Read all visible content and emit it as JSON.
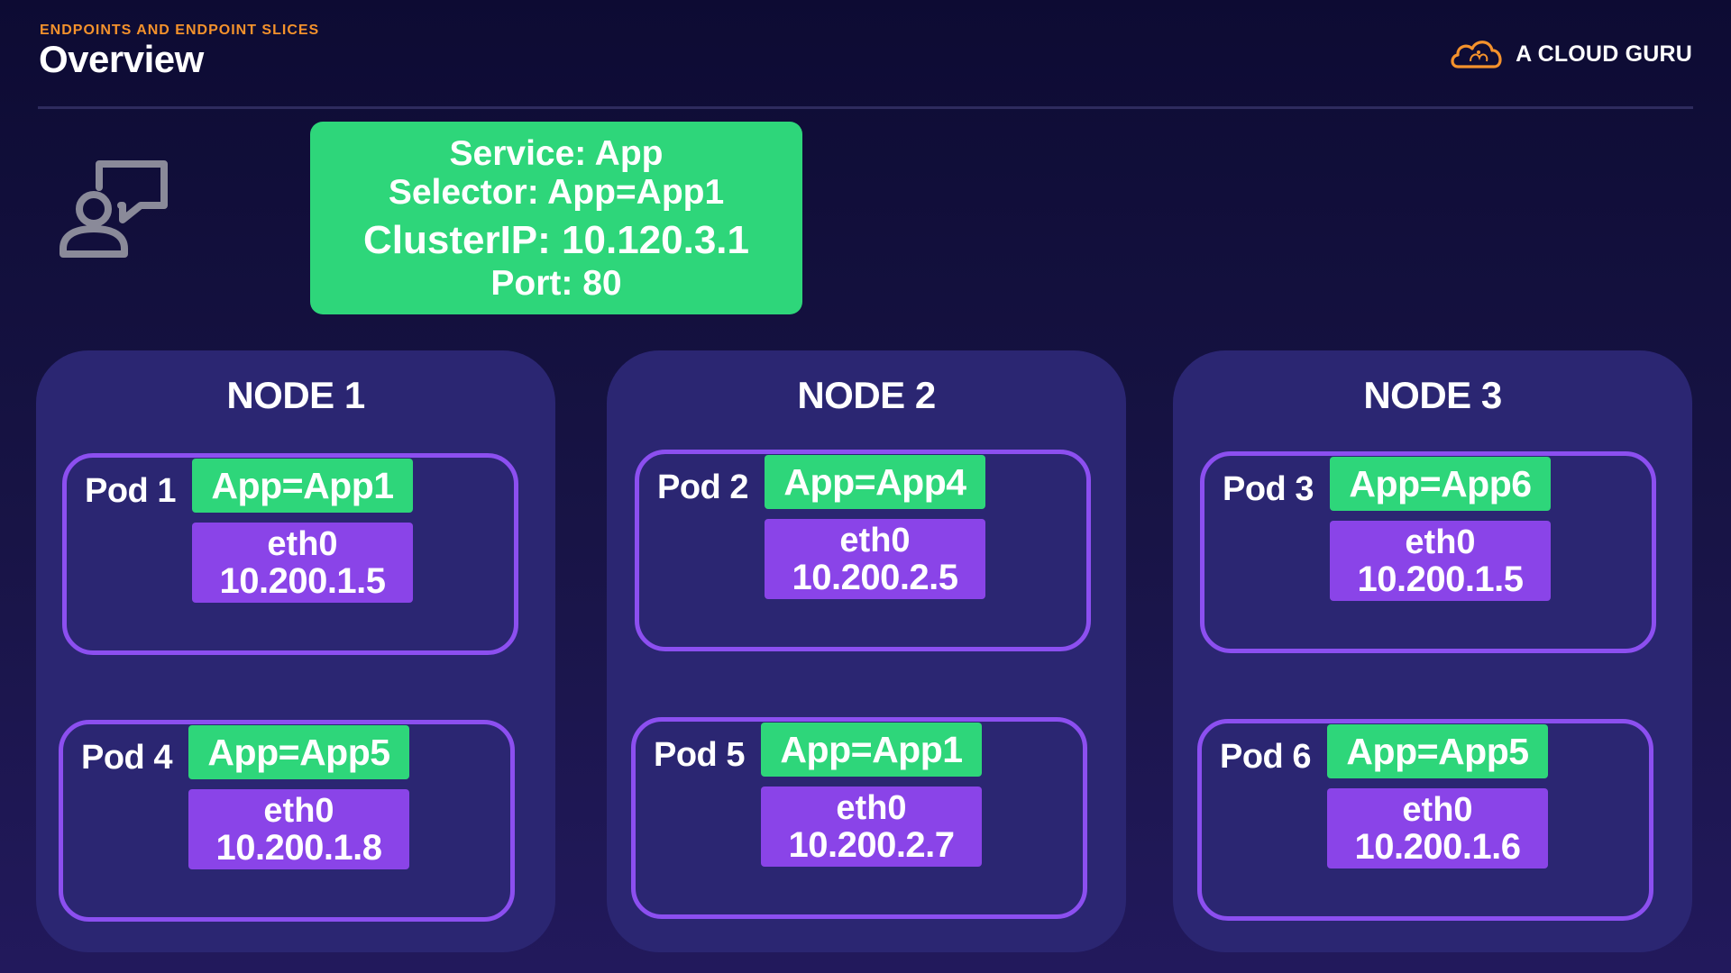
{
  "header": {
    "eyebrow": "ENDPOINTS AND ENDPOINT SLICES",
    "title": "Overview",
    "brand": "A CLOUD GURU"
  },
  "service": {
    "line1": "Service: App",
    "line2": "Selector: App=App1",
    "line3": "ClusterIP: 10.120.3.1",
    "line4": "Port: 80"
  },
  "nodes": [
    {
      "title": "NODE 1",
      "pods": [
        {
          "label": "Pod 1",
          "app": "App=App1",
          "iface": "eth0",
          "ip": "10.200.1.5"
        },
        {
          "label": "Pod 4",
          "app": "App=App5",
          "iface": "eth0",
          "ip": "10.200.1.8"
        }
      ]
    },
    {
      "title": "NODE 2",
      "pods": [
        {
          "label": "Pod 2",
          "app": "App=App4",
          "iface": "eth0",
          "ip": "10.200.2.5"
        },
        {
          "label": "Pod 5",
          "app": "App=App1",
          "iface": "eth0",
          "ip": "10.200.2.7"
        }
      ]
    },
    {
      "title": "NODE 3",
      "pods": [
        {
          "label": "Pod 3",
          "app": "App=App6",
          "iface": "eth0",
          "ip": "10.200.1.5"
        },
        {
          "label": "Pod 6",
          "app": "App=App5",
          "iface": "eth0",
          "ip": "10.200.1.6"
        }
      ]
    }
  ],
  "icons": {
    "user": "user-chat-icon",
    "brand": "cloud-logo-icon"
  },
  "colors": {
    "accent_orange": "#f4922c",
    "service_green": "#2ed67a",
    "pod_border_purple": "#8c4ff0",
    "eth_purple": "#8a44e8",
    "node_bg": "#2b2672",
    "page_bg": "#181446"
  }
}
